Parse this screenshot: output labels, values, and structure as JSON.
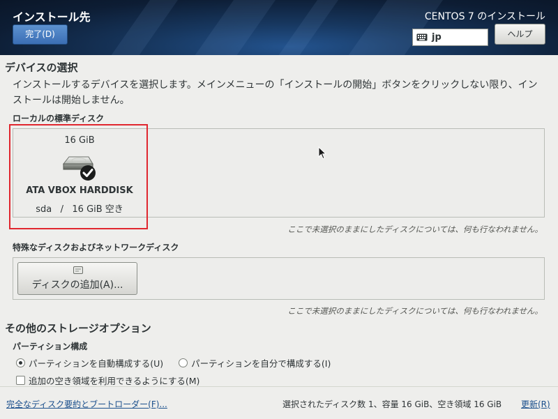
{
  "header": {
    "spoke_title": "インストール先",
    "done_label": "完了(D)",
    "product_title": "CENTOS 7 のインストール",
    "keyboard_layout": "jp",
    "help_label": "ヘルプ"
  },
  "device_selection": {
    "title": "デバイスの選択",
    "description": "インストールするデバイスを選択します。メインメニューの「インストールの開始」ボタンをクリックしない限り、インストールは開始しません。"
  },
  "local_disks": {
    "title": "ローカルの標準ディスク",
    "disks": [
      {
        "size": "16 GiB",
        "name": "ATA VBOX HARDDISK",
        "device": "sda",
        "separator": "/",
        "free": "16 GiB 空き",
        "icon": "harddisk-selected-icon"
      }
    ],
    "hint": "ここで未選択のままにしたディスクについては、何も行なわれません。"
  },
  "special_disks": {
    "title": "特殊なディスクおよびネットワークディスク",
    "add_button_label": "ディスクの追加(A)...",
    "hint": "ここで未選択のままにしたディスクについては、何も行なわれません。"
  },
  "other_options": {
    "title": "その他のストレージオプション",
    "partitioning_title": "パーティション構成",
    "radio_auto": "パーティションを自動構成する(U)",
    "radio_manual": "パーティションを自分で構成する(I)",
    "auto_selected": true,
    "checkbox_label": "追加の空き領域を利用できるようにする(M)",
    "checkbox_checked": false
  },
  "footer": {
    "summary_link": "完全なディスク要約とブートローダー(F)...",
    "summary_text": "選択されたディスク数 1、容量 16 GiB、空き領域 16 GiB",
    "refresh_link": "更新(R)"
  },
  "colors": {
    "accent": "#3b6eb4",
    "highlight_border": "#e0262e",
    "link": "#1a4f8c"
  }
}
